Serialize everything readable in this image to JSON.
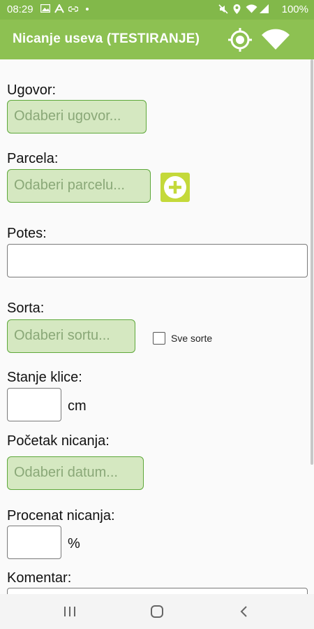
{
  "status_bar": {
    "time": "08:29",
    "battery": "100%",
    "icons": [
      "image-icon",
      "signal-a-icon",
      "link-icon",
      "dot-icon",
      "mute-icon",
      "location-icon",
      "wifi-icon",
      "signal-bars-icon"
    ]
  },
  "app_bar": {
    "title": "Nicanje useva (TESTIRANJE)",
    "icons": [
      "gps-target-icon",
      "wifi-icon"
    ]
  },
  "form": {
    "ugovor": {
      "label": "Ugovor:",
      "placeholder": "Odaberi ugovor..."
    },
    "parcela": {
      "label": "Parcela:",
      "placeholder": "Odaberi parcelu..."
    },
    "potes": {
      "label": "Potes:",
      "value": ""
    },
    "sorta": {
      "label": "Sorta:",
      "placeholder": "Odaberi sortu...",
      "all_varieties_label": "Sve sorte",
      "all_varieties_checked": false
    },
    "stanje_klice": {
      "label": "Stanje klice:",
      "value": "",
      "unit": "cm"
    },
    "pocetak_nicanja": {
      "label": "Početak nicanja:",
      "placeholder": "Odaberi datum..."
    },
    "procenat_nicanja": {
      "label": "Procenat nicanja:",
      "value": "",
      "unit": "%"
    },
    "komentar": {
      "label": "Komentar:",
      "value": ""
    }
  },
  "nav_bar": {
    "icons": [
      "recent-apps-icon",
      "home-icon",
      "back-icon"
    ]
  },
  "colors": {
    "app_bar": "#8dc152",
    "status_bar": "#82b84a",
    "picker_fill": "#d5e8c1",
    "picker_border": "#5ea83a",
    "add_button": "#c4d93a"
  }
}
